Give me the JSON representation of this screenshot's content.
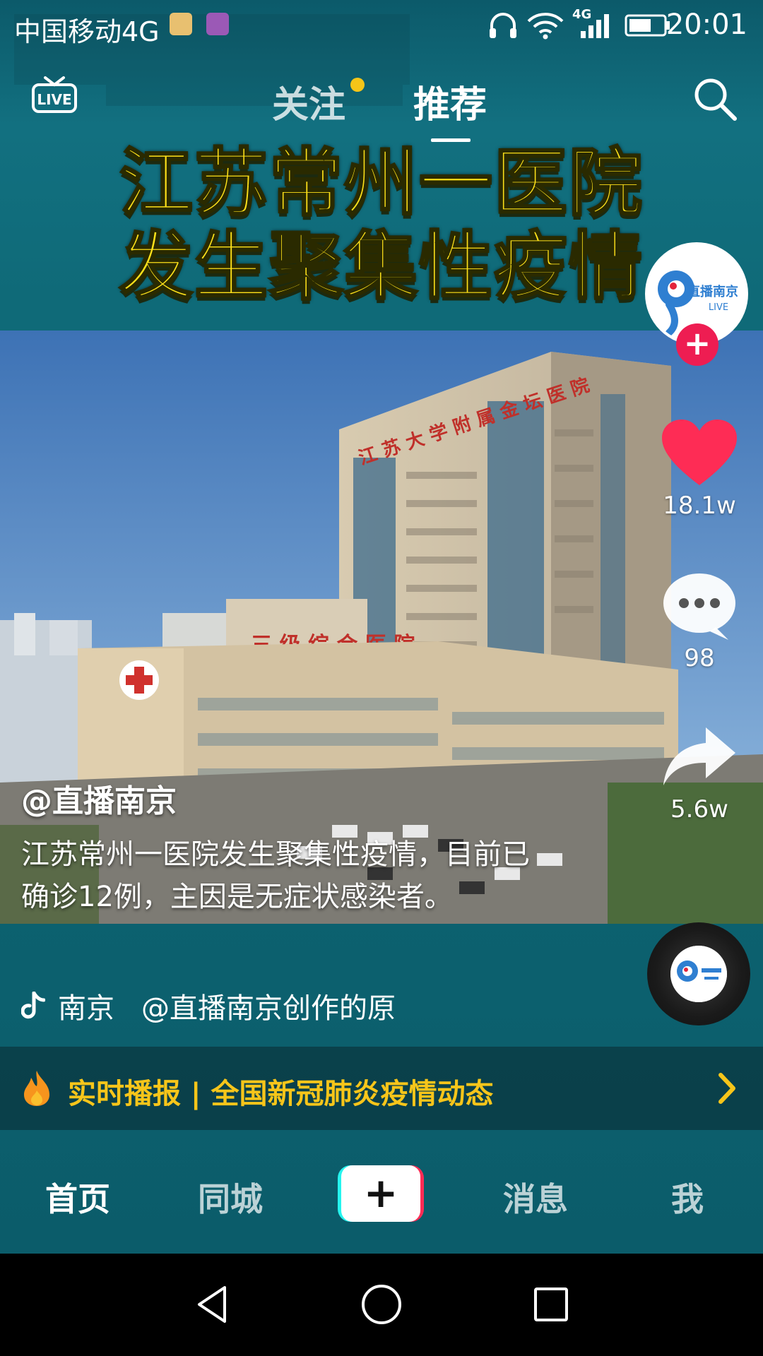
{
  "status_bar": {
    "carrier": "中国移动4G",
    "network_badge": "4G",
    "time": "20:01",
    "icons": [
      "cleaner-app-icon",
      "gallery-app-icon",
      "headphones-icon",
      "wifi-icon",
      "signal-icon",
      "battery-icon"
    ]
  },
  "top_nav": {
    "live_label": "LIVE",
    "tab_follow": "关注",
    "tab_recommend": "推荐",
    "active_tab": "推荐",
    "search_icon": "search-icon"
  },
  "video": {
    "headline_line1": "江苏常州一医院",
    "headline_line2": "发生聚集性疫情",
    "author": "@直播南京",
    "caption": "江苏常州一医院发生聚集性疫情，目前已确诊12例，主因是无症状感染者。",
    "location": "南京",
    "music": "@直播南京创作的原",
    "avatar_text": "直播南京",
    "avatar_subtext": "LIVE"
  },
  "actions": {
    "likes": "18.1w",
    "comments": "98",
    "shares": "5.6w"
  },
  "banner": {
    "text": "实时播报 | 全国新冠肺炎疫情动态"
  },
  "tabbar": {
    "home": "首页",
    "nearby": "同城",
    "create": "+",
    "messages": "消息",
    "me": "我"
  },
  "colors": {
    "accent_yellow": "#ffe21a",
    "banner_text": "#f7c51a",
    "like_red": "#fe2c55",
    "follow_plus": "#ee1d52",
    "teal_bg": "#0f6a78"
  }
}
